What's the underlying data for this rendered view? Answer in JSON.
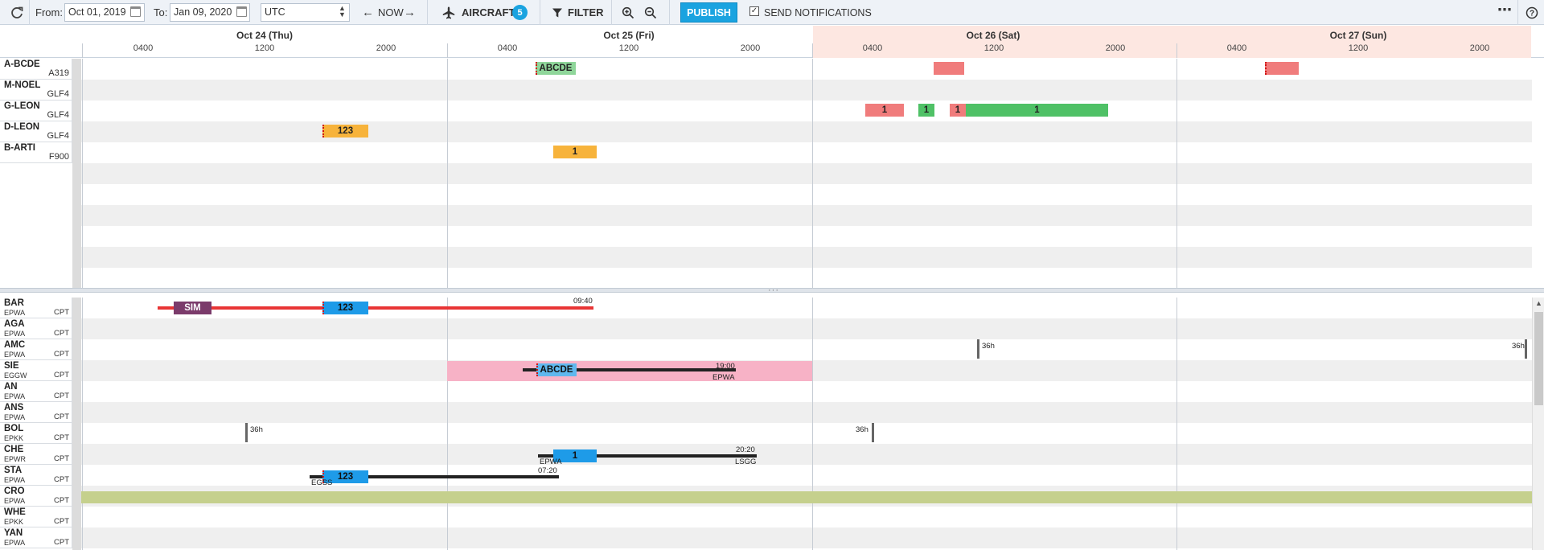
{
  "toolbar": {
    "from_label": "From:",
    "from_value": "Oct 01, 2019",
    "to_label": "To:",
    "to_value": "Jan 09, 2020",
    "timezone": "UTC",
    "now_label": "NOW",
    "aircraft_label": "AIRCRAFT",
    "aircraft_count": "5",
    "filter_label": "FILTER",
    "publish_label": "PUBLISH",
    "notifications_label": "SEND NOTIFICATIONS",
    "notifications_checked": true,
    "more_icon": "more-dots-icon",
    "help_icon": "help-icon"
  },
  "timeline": {
    "days": [
      "Oct 24 (Thu)",
      "Oct 25 (Fri)",
      "Oct 26 (Sat)",
      "Oct 27 (Sun)"
    ],
    "highlighted_days": [
      "Oct 26 (Sat)",
      "Oct 27 (Sun)"
    ],
    "ticks": [
      "0400",
      "1200",
      "2000"
    ]
  },
  "aircraft": [
    {
      "code": "A-BCDE",
      "type": "A319"
    },
    {
      "code": "M-NOEL",
      "type": "GLF4"
    },
    {
      "code": "G-LEON",
      "type": "GLF4"
    },
    {
      "code": "D-LEON",
      "type": "GLF4"
    },
    {
      "code": "B-ARTI",
      "type": "F900"
    }
  ],
  "aircraft_blocks": {
    "abcde_label": "ABCDE",
    "one": "1",
    "d_leon_label": "123"
  },
  "crew": [
    {
      "code": "BAR",
      "base": "EPWA",
      "role": "CPT"
    },
    {
      "code": "AGA",
      "base": "EPWA",
      "role": "CPT"
    },
    {
      "code": "AMC",
      "base": "EPWA",
      "role": "CPT"
    },
    {
      "code": "SIE",
      "base": "EGGW",
      "role": "CPT"
    },
    {
      "code": "AN",
      "base": "EPWA",
      "role": "CPT"
    },
    {
      "code": "ANS",
      "base": "EPWA",
      "role": "CPT"
    },
    {
      "code": "BOL",
      "base": "EPKK",
      "role": "CPT"
    },
    {
      "code": "CHE",
      "base": "EPWR",
      "role": "CPT"
    },
    {
      "code": "STA",
      "base": "EPWA",
      "role": "CPT"
    },
    {
      "code": "CRO",
      "base": "EPWA",
      "role": "CPT"
    },
    {
      "code": "WHE",
      "base": "EPKK",
      "role": "CPT"
    },
    {
      "code": "YAN",
      "base": "EPWA",
      "role": "CPT"
    }
  ],
  "crew_blocks": {
    "sim_label": "SIM",
    "bar_flight": "123",
    "bar_time": "09:40",
    "amc_rest_1": "36h",
    "amc_rest_2": "36h",
    "sie_flight": "ABCDE",
    "sie_time": "19:00",
    "sie_dest": "EPWA",
    "bol_rest_1": "36h",
    "bol_rest_2": "36h",
    "che_flight": "1",
    "che_time": "20:20",
    "che_origin": "EPWA",
    "che_dest": "LSGG",
    "sta_flight": "123",
    "sta_time": "07:20",
    "sta_origin": "EGSS"
  },
  "colors": {
    "accent": "#1aa3e0",
    "weekend": "#fde7e1",
    "pink_block": "#f07c7c",
    "green_block": "#4fc166",
    "orange_block": "#f7b33b",
    "crew_flight": "#1e9be8",
    "sim": "#7b3b6b",
    "duty_pink": "#f7b2c6",
    "olive": "#c5d08d"
  }
}
